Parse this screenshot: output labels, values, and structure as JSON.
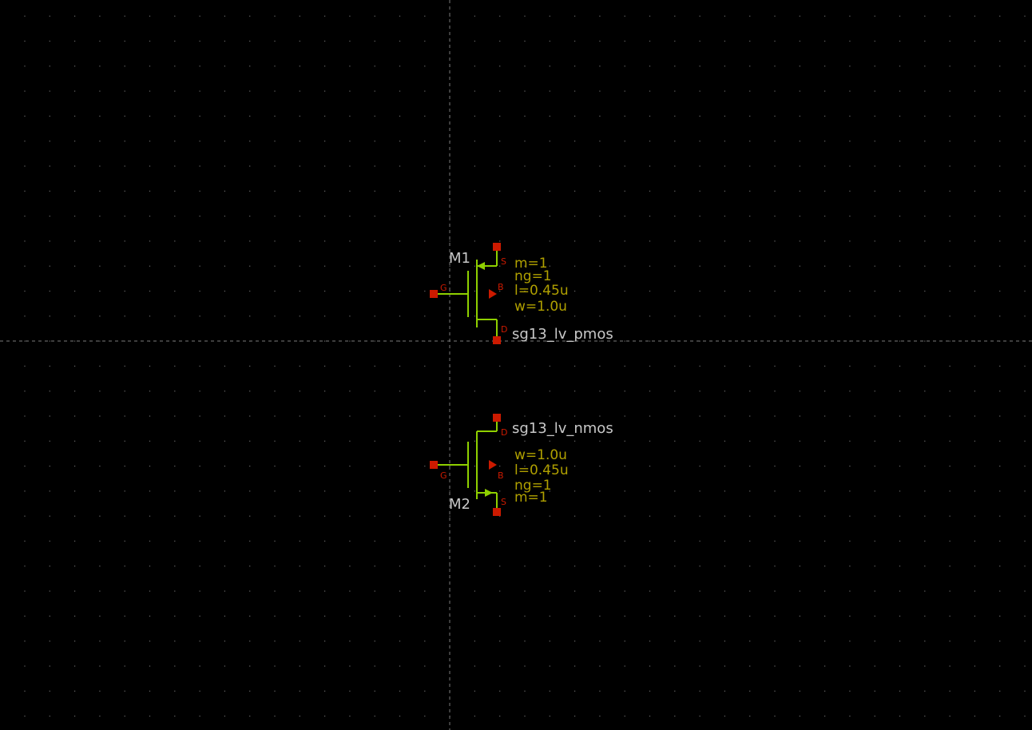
{
  "colors": {
    "background": "#000000",
    "grid_dot": "#6a6a6a",
    "axis": "#7a7a7a",
    "wire": "#8fd000",
    "pin": "#cc1a00",
    "instance_text": "#c8c8c8",
    "param_text": "#b0a000"
  },
  "schematic": {
    "M1": {
      "name": "M1",
      "model": "sg13_lv_pmos",
      "pins": {
        "s": "S",
        "g": "G",
        "b": "B",
        "d": "D"
      },
      "params": {
        "m": "m=1",
        "ng": "ng=1",
        "l": "l=0.45u",
        "w": "w=1.0u"
      }
    },
    "M2": {
      "name": "M2",
      "model": "sg13_lv_nmos",
      "pins": {
        "d": "D",
        "g": "G",
        "b": "B",
        "s": "S"
      },
      "params": {
        "w": "w=1.0u",
        "l": "l=0.45u",
        "ng": "ng=1",
        "m": "m=1"
      }
    }
  }
}
